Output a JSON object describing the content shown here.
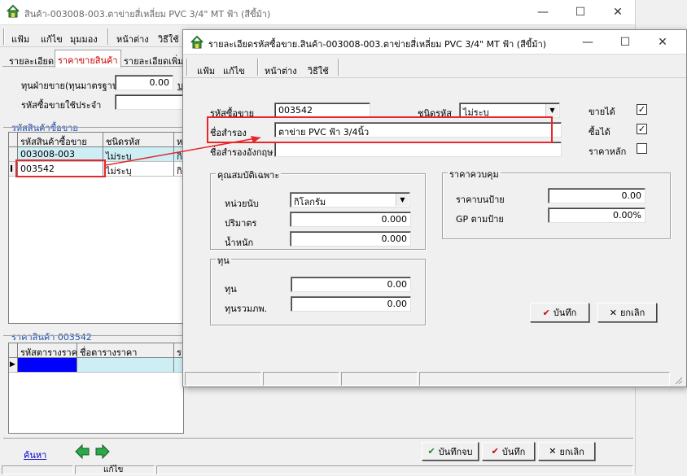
{
  "main_window": {
    "title": "สินค้า-003008-003.ตาข่ายสี่เหลี่ยม PVC 3/4\" MT ฟ้า (สีขี้ม้า)",
    "menu": [
      "แฟ้ม",
      "แก้ไข",
      "มุมมอง",
      "หน้าต่าง",
      "วิธีใช้"
    ],
    "tabs": [
      "รายละเอียด",
      "ราคาขายสินค้า",
      "รายละเอียดเพิ่ม"
    ],
    "cost_label": "ทุนฝ่ายขาย(ทุนมาตรฐาน)",
    "cost_value": "0.00",
    "buyer_code_label": "รหัสซื้อขายใช้ประจำ",
    "buyer_code_value": "",
    "product_codes_section": "รหัสสินค้าซื้อขาย",
    "product_codes_columns": [
      "รหัสสินค้าซื้อขาย",
      "ชนิดรหัส",
      "ห"
    ],
    "product_codes_rows": [
      [
        "003008-003",
        "ไม่ระบุ",
        "กิ"
      ],
      [
        "003542",
        "ไม่ระบุ",
        "กิ"
      ]
    ],
    "price_section": "ราคาสินค้า 003542",
    "price_columns": [
      "รหัสตารางราคา",
      "ชื่อตารางราคา",
      "ร"
    ],
    "search_link": "ค้นหา",
    "save_close_label": "บันทึกจบ",
    "save_label": "บันทึก",
    "cancel_label": "ยกเลิก",
    "status_text": "แก้ไข"
  },
  "dialog": {
    "title": "รายละเอียดรหัสซื้อขาย.สินค้า-003008-003.ตาข่ายสี่เหลี่ยม PVC 3/4\" MT ฟ้า (สีขี้ม้า)",
    "menu": [
      "แฟ้ม",
      "แก้ไข",
      "หน้าต่าง",
      "วิธีใช้"
    ],
    "trade_code_label": "รหัสซื้อขาย",
    "trade_code_value": "003542",
    "code_type_label": "ชนิดรหัส",
    "code_type_value": "ไม่ระบุ",
    "alt_name_label": "ชื่อสำรอง",
    "alt_name_value": "ตาข่าย PVC ฟ้า 3/4นิ้ว",
    "alt_name_en_label": "ชื่อสำรองอังกฤษ",
    "alt_name_en_value": "",
    "can_sell_label": "ขายได้",
    "can_sell": true,
    "can_buy_label": "ซื้อได้",
    "can_buy": true,
    "main_price_label": "ราคาหลัก",
    "main_price": false,
    "props_group": "คุณสมบัติเฉพาะ",
    "unit_label": "หน่วยนับ",
    "unit_value": "กิโลกรัม",
    "volume_label": "ปริมาตร",
    "volume_value": "0.000",
    "weight_label": "น้ำหนัก",
    "weight_value": "0.000",
    "control_price_group": "ราคาควบคุม",
    "tag_price_label": "ราคาบนป้าย",
    "tag_price_value": "0.00",
    "gp_label": "GP ตามป้าย",
    "gp_value": "0.00%",
    "cost_group": "ทุน",
    "cost_label": "ทุน",
    "cost_value": "0.00",
    "cost_vat_label": "ทุนรวมภพ.",
    "cost_vat_value": "0.00",
    "save_label": "บันทึก",
    "cancel_label": "ยกเลิก"
  },
  "colors": {
    "highlight_red": "#e8262b",
    "grid_selected": "#0000ff",
    "grid_row_alt": "#cdeef5",
    "tab_active": "#cc0000",
    "section_blue": "#1f4fb0"
  }
}
